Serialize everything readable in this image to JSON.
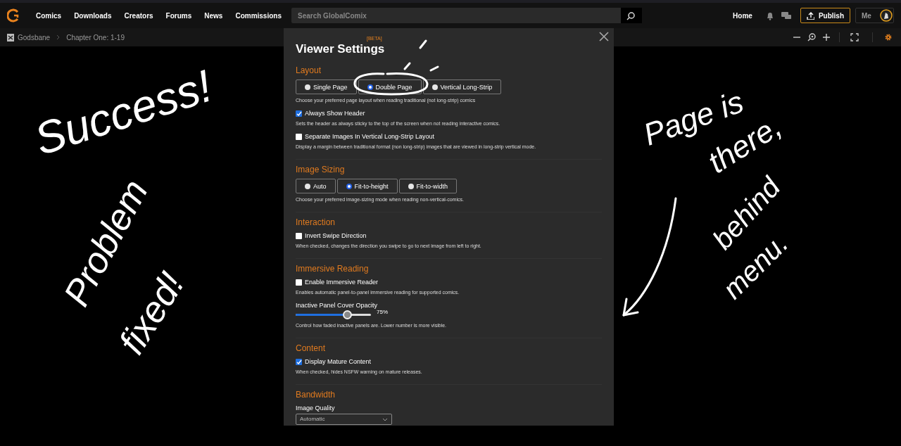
{
  "nav": {
    "links": [
      "Comics",
      "Downloads",
      "Creators",
      "Forums",
      "News",
      "Commissions"
    ],
    "search": {
      "placeholder": "Search GlobalComix"
    },
    "home": "Home",
    "publish": "Publish",
    "me": "Me"
  },
  "breadcrumb": [
    "Godsbane",
    "Chapter One: 1-19"
  ],
  "modal": {
    "title": "Viewer Settings",
    "badge": "[BETA]",
    "sections": [
      {
        "heading": "Layout",
        "items": [
          {
            "kind": "radio_group",
            "options": [
              {
                "label": "Single Page",
                "selected": false
              },
              {
                "label": "Double Page",
                "selected": true
              },
              {
                "label": "Vertical Long-Strip",
                "selected": false
              }
            ],
            "description": "Choose your preferred page layout when reading traditional (not long-strip) comics"
          },
          {
            "kind": "checkbox",
            "label": "Always Show Header",
            "checked": true,
            "description": "Sets the header as always sticky to the top of the screen when not reading interactive comics."
          },
          {
            "kind": "checkbox",
            "label": "Separate Images In Vertical Long-Strip Layout",
            "checked": false,
            "description": "Display a margin between traditional format (non long-strip) images that are viewed in long-strip vertical mode."
          }
        ]
      },
      {
        "heading": "Image Sizing",
        "items": [
          {
            "kind": "radio_group",
            "options": [
              {
                "label": "Auto",
                "selected": false
              },
              {
                "label": "Fit-to-height",
                "selected": true
              },
              {
                "label": "Fit-to-width",
                "selected": false
              }
            ],
            "description": "Choose your preferred image-sizing mode when reading non-vertical-comics."
          }
        ]
      },
      {
        "heading": "Interaction",
        "items": [
          {
            "kind": "checkbox",
            "label": "Invert Swipe Direction",
            "checked": false,
            "description": "When checked, changes the direction you swipe to go to next image from left to right."
          }
        ]
      },
      {
        "heading": "Immersive Reading",
        "items": [
          {
            "kind": "checkbox",
            "label": "Enable Immersive Reader",
            "checked": false,
            "description": "Enables automatic panel-to-panel immersive reading for supported comics."
          },
          {
            "kind": "slider",
            "label": "Inactive Panel Cover Opacity",
            "level": 0.68,
            "reading": "75%",
            "description": "Control how faded inactive panels are. Lower number is more visible."
          }
        ]
      },
      {
        "heading": "Content",
        "items": [
          {
            "kind": "checkbox",
            "label": "Display Mature Content",
            "checked": true,
            "description": "When checked, hides NSFW warning on mature releases."
          }
        ]
      },
      {
        "heading": "Bandwidth",
        "items": [
          {
            "kind": "select",
            "label": "Image Quality",
            "value": "Automatic"
          }
        ]
      }
    ]
  },
  "annotations": [
    "Success!",
    "Problem",
    "fixed!",
    "Page is",
    "there,",
    "behind",
    "menu."
  ]
}
